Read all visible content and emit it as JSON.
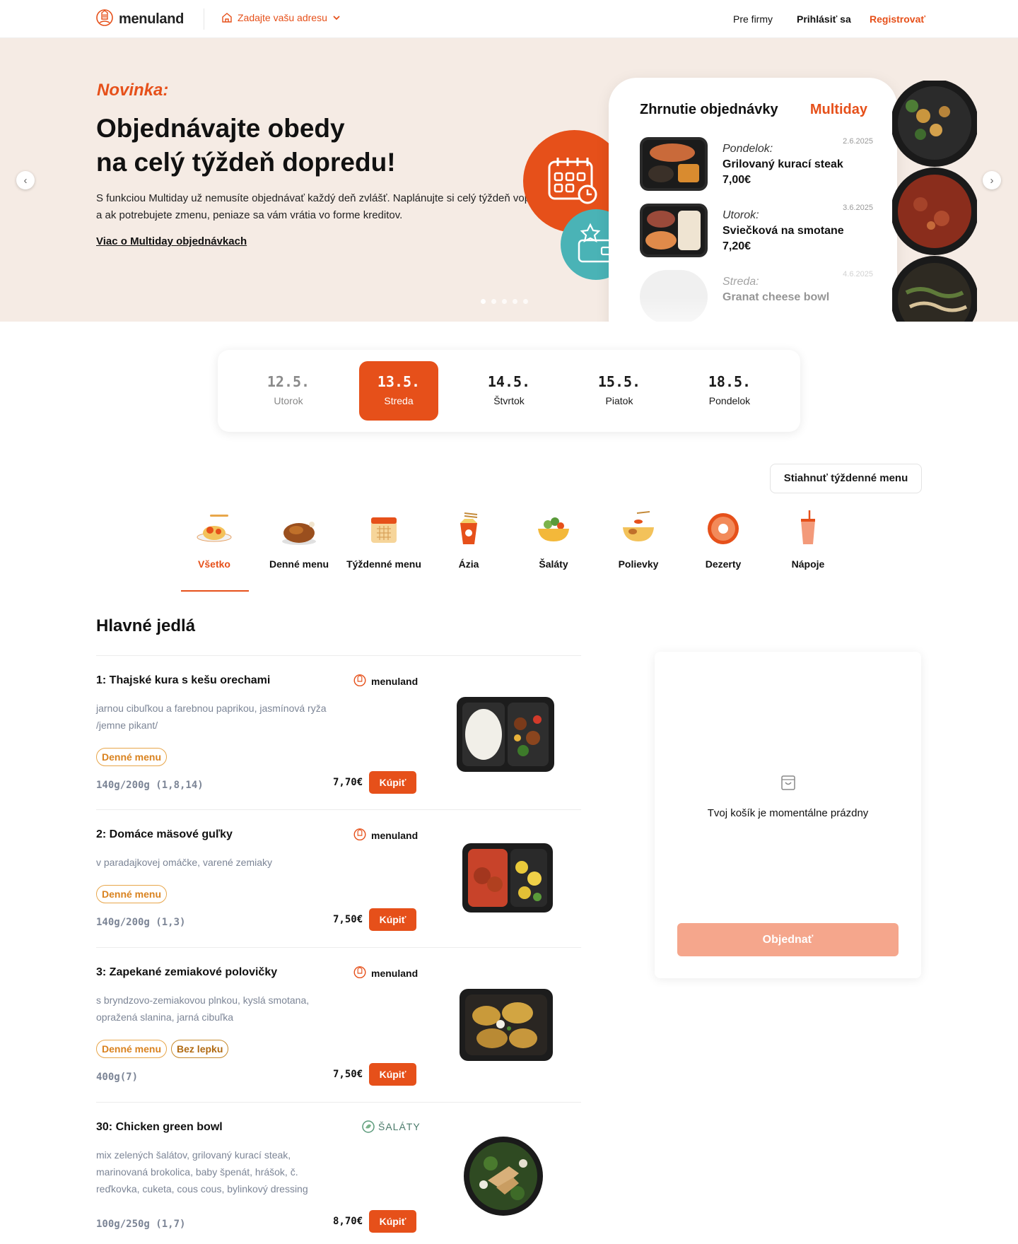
{
  "header": {
    "brand": "menuland",
    "address_placeholder": "Zadajte vašu adresu",
    "nav_firmy": "Pre firmy",
    "nav_login": "Prihlásiť sa",
    "nav_register": "Registrovať"
  },
  "hero": {
    "kicker": "Novinka:",
    "title_line1": "Objednávajte obedy",
    "title_line2": "na celý týždeň dopredu!",
    "text": "S funkciou Multiday už nemusíte objednávať každý deň zvlášť. Naplánujte si celý týždeň vopred a ak potrebujete zmenu, peniaze sa vám vrátia vo forme kreditov.",
    "link": "Viac o Multiday objednávkach",
    "summary_title": "Zhrnutie objednávky",
    "summary_badge": "Multiday",
    "summary_items": [
      {
        "day": "Pondelok:",
        "name": "Grilovaný kurací steak",
        "price": "7,00€",
        "date": "2.6.2025"
      },
      {
        "day": "Utorok:",
        "name": "Sviečková na smotane",
        "price": "7,20€",
        "date": "3.6.2025"
      },
      {
        "day": "Streda:",
        "name": "Granat cheese bowl",
        "date": "4.6.2025"
      }
    ],
    "slide_count": 5,
    "active_slide": 1
  },
  "dates": [
    {
      "date": "12.5.",
      "weekday": "Utorok",
      "state": "past"
    },
    {
      "date": "13.5.",
      "weekday": "Streda",
      "state": "active"
    },
    {
      "date": "14.5.",
      "weekday": "Štvrtok",
      "state": "normal"
    },
    {
      "date": "15.5.",
      "weekday": "Piatok",
      "state": "normal"
    },
    {
      "date": "18.5.",
      "weekday": "Pondelok",
      "state": "normal"
    }
  ],
  "download_button": "Stiahnuť týždenné menu",
  "categories": [
    {
      "label": "Všetko",
      "icon": "pasta-icon",
      "active": true
    },
    {
      "label": "Denné menu",
      "icon": "roast-chicken-icon"
    },
    {
      "label": "Týždenné menu",
      "icon": "calendar-icon"
    },
    {
      "label": "Ázia",
      "icon": "noodle-box-icon"
    },
    {
      "label": "Šaláty",
      "icon": "salad-bowl-icon"
    },
    {
      "label": "Polievky",
      "icon": "soup-bowl-icon"
    },
    {
      "label": "Dezerty",
      "icon": "donut-icon"
    },
    {
      "label": "Nápoje",
      "icon": "drink-cup-icon"
    }
  ],
  "section_title": "Hlavné jedlá",
  "menu_items": [
    {
      "title": "1: Thajské kura s kešu orechami",
      "desc": "jarnou cibuľkou a farebnou paprikou, jasmínová ryža /jemne pikant/",
      "brand": "menuland",
      "tags": [
        "Denné menu"
      ],
      "weight": "140g/200g (1,8,14)",
      "price": "7,70€",
      "buy": "Kúpiť"
    },
    {
      "title": "2: Domáce mäsové guľky",
      "desc": "v paradajkovej omáčke, varené zemiaky",
      "brand": "menuland",
      "tags": [
        "Denné menu"
      ],
      "weight": "140g/200g (1,3)",
      "price": "7,50€",
      "buy": "Kúpiť"
    },
    {
      "title": "3: Zapekané zemiakové polovičky",
      "desc": "s bryndzovo-zemiakovou plnkou, kyslá smotana, opražená slanina, jarná cibuľka",
      "brand": "menuland",
      "tags": [
        "Denné menu",
        "Bez lepku"
      ],
      "weight": "400g(7)",
      "price": "7,50€",
      "buy": "Kúpiť"
    },
    {
      "title": "30: Chicken green bowl",
      "desc": "mix zelených šalátov, grilovaný kurací steak, marinovaná brokolica, baby špenát, hrášok, č. reďkovka, cuketa, cous cous, bylinkový dressing",
      "brand": "ŠALÁTY",
      "tags": [],
      "weight": "100g/250g (1,7)",
      "price": "8,70€",
      "buy": "Kúpiť"
    }
  ],
  "cart": {
    "empty_text": "Tvoj košík je momentálne prázdny",
    "order_button": "Objednať"
  },
  "colors": {
    "accent": "#e6501a",
    "hero_bg": "#f5ebe4",
    "teal": "#4ab3b6",
    "order_disabled": "#f5a68c"
  }
}
